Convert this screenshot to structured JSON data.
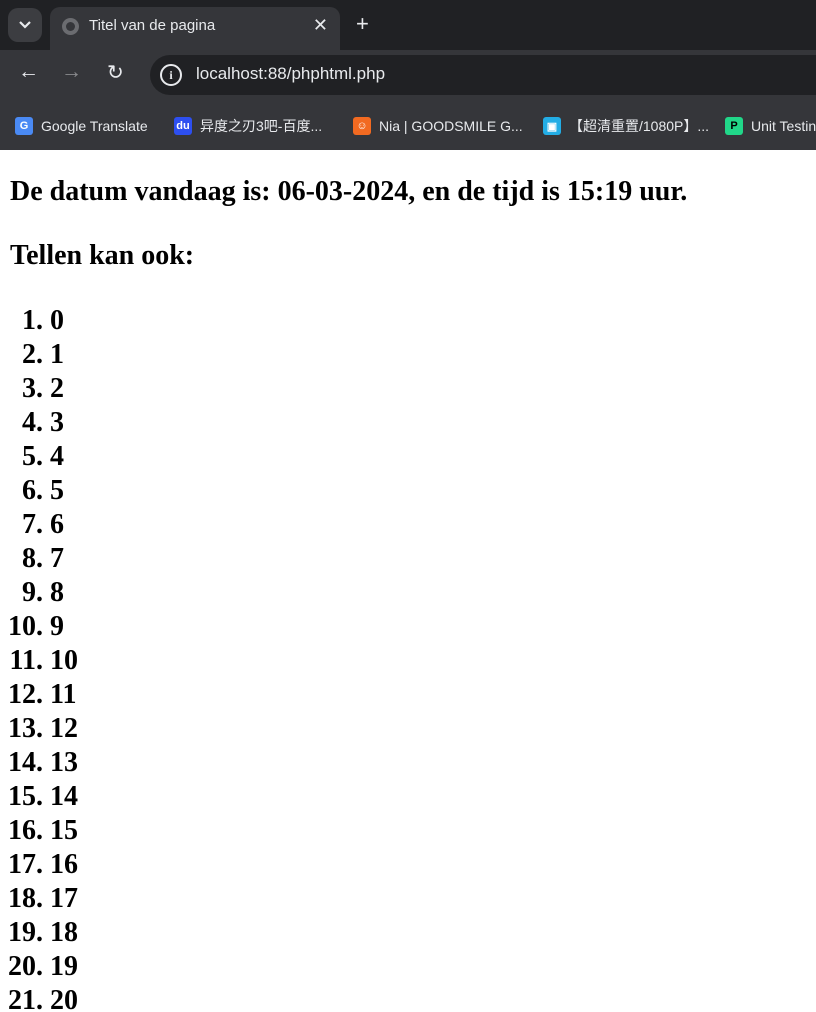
{
  "browser": {
    "tab_title": "Titel van de pagina",
    "url": "localhost:88/phphtml.php",
    "bookmarks": [
      {
        "label": "Google Translate",
        "icon": "google-translate-icon",
        "color": "#4a8af4"
      },
      {
        "label": "异度之刃3吧-百度...",
        "icon": "baidu-icon",
        "color": "#2d4ff0"
      },
      {
        "label": "Nia | GOODSMILE G...",
        "icon": "goodsmile-icon",
        "color": "#f26a21"
      },
      {
        "label": "【超清重置/1080P】...",
        "icon": "bilibili-icon",
        "color": "#23ade5"
      },
      {
        "label": "Unit Testin",
        "icon": "unit-testing-icon",
        "color": "#21d789"
      }
    ]
  },
  "page": {
    "heading": "De datum vandaag is: 06-03-2024, en de tijd is 15:19 uur.",
    "subheading": "Tellen kan ook:",
    "items": [
      "0",
      "1",
      "2",
      "3",
      "4",
      "5",
      "6",
      "7",
      "8",
      "9",
      "10",
      "11",
      "12",
      "13",
      "14",
      "15",
      "16",
      "17",
      "18",
      "19",
      "20"
    ]
  }
}
